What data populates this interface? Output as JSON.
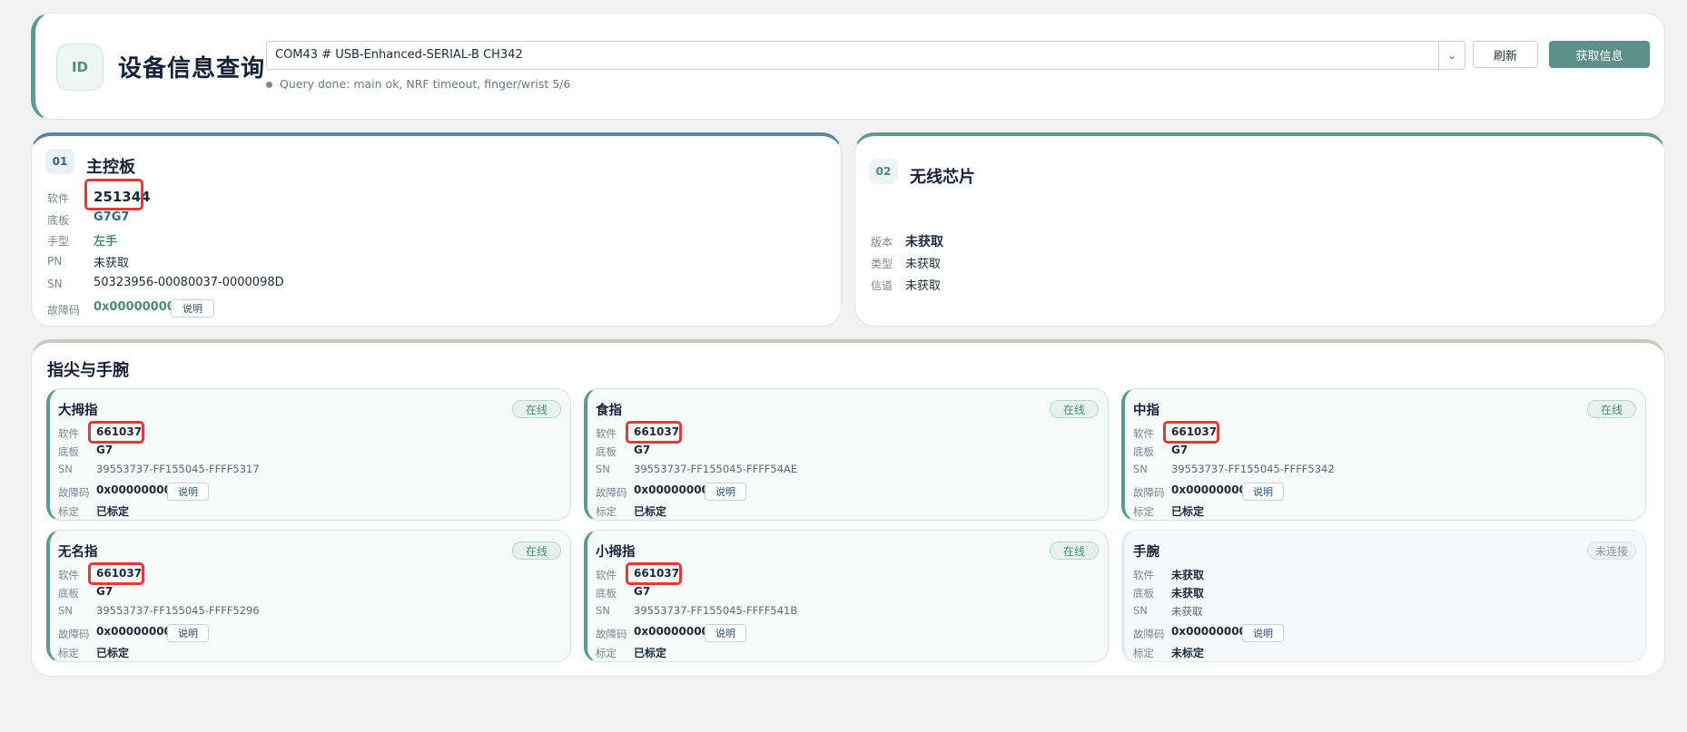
{
  "header": {
    "badge": "ID",
    "title": "设备信息查询",
    "port": "COM43 # USB-Enhanced-SERIAL-B CH342",
    "status": "Query done: main ok, NRF timeout, finger/wrist 5/6",
    "refresh_label": "刷新",
    "fetch_label": "获取信息"
  },
  "main_board": {
    "num": "01",
    "title": "主控板",
    "rows": [
      {
        "label": "软件",
        "value": "251344"
      },
      {
        "label": "底板",
        "value": "G7G7"
      },
      {
        "label": "手型",
        "value": "左手"
      },
      {
        "label": "PN",
        "value": "未获取"
      },
      {
        "label": "SN",
        "value": "50323956-00080037-0000098D"
      },
      {
        "label": "故障码",
        "value": "0x00000000"
      }
    ],
    "explain_label": "说明"
  },
  "wireless": {
    "num": "02",
    "title": "无线芯片",
    "rows": [
      {
        "label": "版本",
        "value": "未获取"
      },
      {
        "label": "类型",
        "value": "未获取"
      },
      {
        "label": "信道",
        "value": "未获取"
      }
    ]
  },
  "fingers": {
    "title": "指尖与手腕",
    "labels": {
      "sw": "软件",
      "board": "底板",
      "sn": "SN",
      "fault": "故障码",
      "calib": "标定"
    },
    "explain_label": "说明",
    "cards": [
      {
        "name": "大拇指",
        "status": "在线",
        "sw": "661037",
        "board": "G7",
        "sn": "39553737-FF155045-FFFF5317",
        "fault": "0x00000000",
        "calib": "已标定"
      },
      {
        "name": "食指",
        "status": "在线",
        "sw": "661037",
        "board": "G7",
        "sn": "39553737-FF155045-FFFF54AE",
        "fault": "0x00000000",
        "calib": "已标定"
      },
      {
        "name": "中指",
        "status": "在线",
        "sw": "661037",
        "board": "G7",
        "sn": "39553737-FF155045-FFFF5342",
        "fault": "0x00000000",
        "calib": "已标定"
      },
      {
        "name": "无名指",
        "status": "在线",
        "sw": "661037",
        "board": "G7",
        "sn": "39553737-FF155045-FFFF5296",
        "fault": "0x00000000",
        "calib": "已标定"
      },
      {
        "name": "小拇指",
        "status": "在线",
        "sw": "661037",
        "board": "G7",
        "sn": "39553737-FF155045-FFFF541B",
        "fault": "0x00000000",
        "calib": "已标定"
      },
      {
        "name": "手腕",
        "status": "未连接",
        "sw": "未获取",
        "board": "未获取",
        "sn": "未获取",
        "fault": "0x00000000",
        "calib": "未标定"
      }
    ]
  },
  "colors": {
    "accent": "#5b9189",
    "blue": "#2d6796",
    "highlight": "#e53935"
  }
}
